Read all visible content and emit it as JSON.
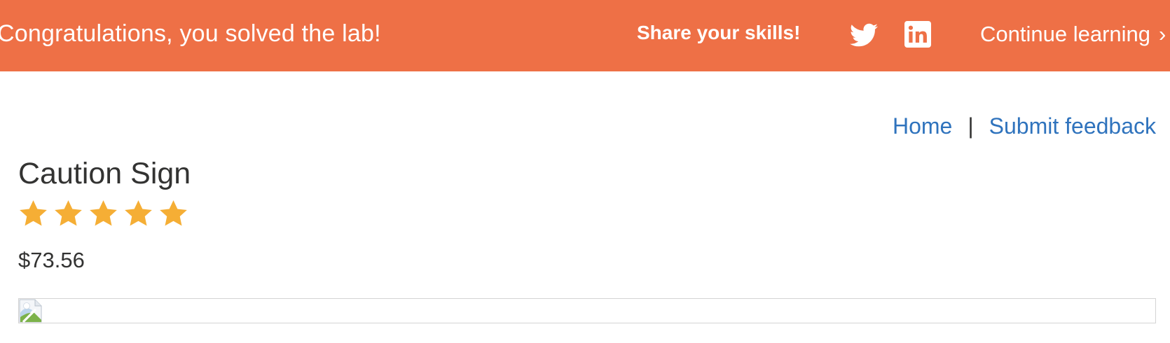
{
  "banner": {
    "message": "Congratulations, you solved the lab!",
    "share_label": "Share your skills!",
    "social_icons": [
      "twitter-icon",
      "linkedin-icon"
    ],
    "continue_label": "Continue learning",
    "continue_chevron": "›",
    "background_color": "#ee7046"
  },
  "nav": {
    "home_label": "Home",
    "separator": "|",
    "feedback_label": "Submit feedback",
    "link_color": "#2f73bd"
  },
  "product": {
    "title": "Caution Sign",
    "rating": 5,
    "rating_max": 5,
    "star_color": "#f5ae35",
    "price": "$73.56",
    "image_icon": "broken-image-icon"
  }
}
